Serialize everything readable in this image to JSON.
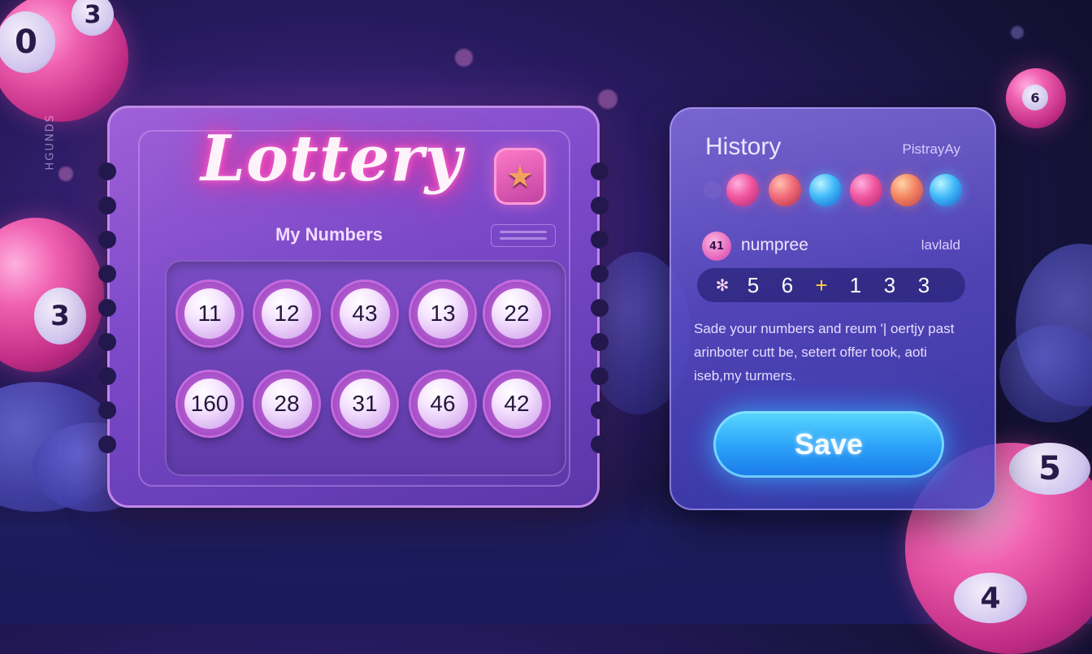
{
  "ticket": {
    "side_code": "HGUNDS",
    "title": "Lottery",
    "subtitle": "My Numbers",
    "star_badge_icon": "star-icon",
    "numbers": [
      "11",
      "12",
      "43",
      "13",
      "22",
      "160",
      "28",
      "31",
      "46",
      "42"
    ]
  },
  "history": {
    "title": "History",
    "header_right": "PistrayAy",
    "recent_balls": [
      "pink",
      "coral",
      "blue",
      "pink",
      "orange",
      "blue"
    ],
    "entry_badge": "41",
    "entry_name": "numpree",
    "entry_right": "lavlald",
    "draw": [
      "5",
      "6",
      "+",
      "1",
      "3",
      "3"
    ],
    "draw_icon": "sparkle-icon",
    "description": "Sade your numbers and reum '| oertjy past arinboter cutt be, setert offer took, aoti iseb,my turmers.",
    "save_label": "Save"
  },
  "decor": {
    "ball_top_left": "0",
    "ball_top_left_edge": "3",
    "ball_left": "3",
    "ball_top_right": "6",
    "ball_bottom_right": "5",
    "ball_bottom_right_lower": "4"
  },
  "colors": {
    "neon_pink": "#ff3caa",
    "ticket_purple": "#7a48c8",
    "save_blue": "#2aa0f8",
    "background": "#141236"
  }
}
